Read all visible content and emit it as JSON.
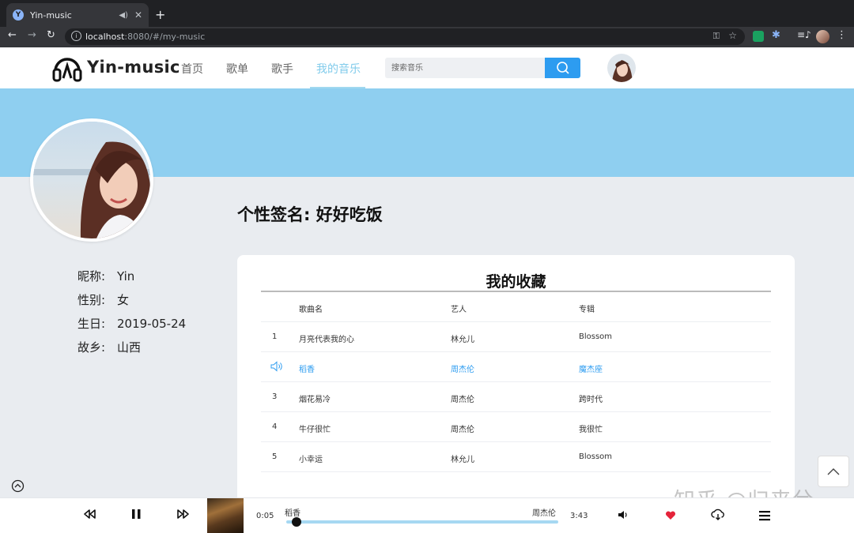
{
  "browser": {
    "tab_title": "Yin-music",
    "url_host": "localhost",
    "url_rest": ":8080/#/my-music"
  },
  "header": {
    "logo_text": "Yin-music",
    "nav": [
      {
        "label": "首页"
      },
      {
        "label": "歌单"
      },
      {
        "label": "歌手"
      },
      {
        "label": "我的音乐",
        "active": true
      }
    ],
    "search_placeholder": "搜索音乐"
  },
  "profile": {
    "signature_label": "个性签名:",
    "signature": "好好吃饭",
    "fields": [
      {
        "label": "昵称:",
        "value": "Yin"
      },
      {
        "label": "性别:",
        "value": "女"
      },
      {
        "label": "生日:",
        "value": "2019-05-24"
      },
      {
        "label": "故乡:",
        "value": "山西"
      }
    ]
  },
  "favorites": {
    "title": "我的收藏",
    "columns": {
      "name": "歌曲名",
      "artist": "艺人",
      "album": "专辑"
    },
    "rows": [
      {
        "idx": "1",
        "name": "月亮代表我的心",
        "artist": "林允儿",
        "album": "Blossom"
      },
      {
        "idx": "",
        "name": "稻香",
        "artist": "周杰伦",
        "album": "魔杰座",
        "playing": true
      },
      {
        "idx": "3",
        "name": "烟花易冷",
        "artist": "周杰伦",
        "album": "跨时代"
      },
      {
        "idx": "4",
        "name": "牛仔很忙",
        "artist": "周杰伦",
        "album": "我很忙"
      },
      {
        "idx": "5",
        "name": "小幸运",
        "artist": "林允儿",
        "album": "Blossom"
      }
    ]
  },
  "player": {
    "current_time": "0:05",
    "total_time": "3:43",
    "song": "稻香",
    "singer": "周杰伦",
    "progress": 0.02
  },
  "watermark": "知乎 @归来兮",
  "colors": {
    "accent": "#2d9cf0",
    "banner": "#8fcff0",
    "nav_active": "#80cbeb",
    "like": "#e5233a"
  }
}
